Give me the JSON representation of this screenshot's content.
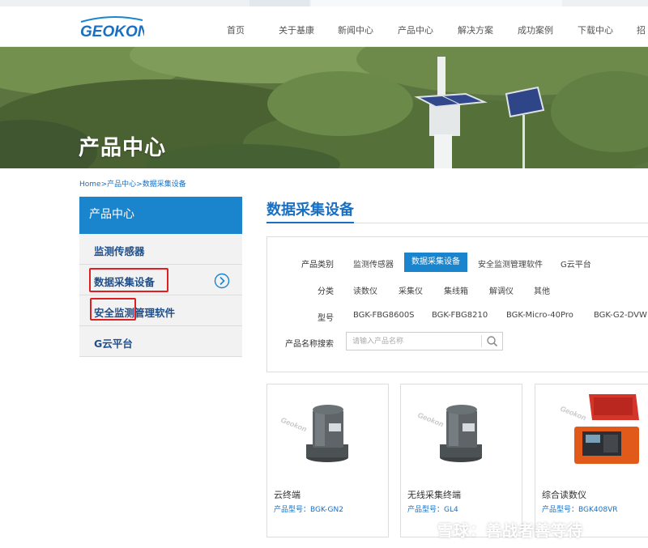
{
  "header": {
    "logo_text": "GEOKON",
    "nav": [
      "首页",
      "关于基康",
      "新闻中心",
      "产品中心",
      "解决方案",
      "成功案例",
      "下载中心",
      "招"
    ]
  },
  "hero": {
    "title": "产品中心"
  },
  "breadcrumb": {
    "items": [
      "Home",
      "产品中心",
      "数据采集设备"
    ],
    "separator": ">"
  },
  "sidebar": {
    "title": "产品中心",
    "items": [
      {
        "label": "监测传感器"
      },
      {
        "label": "数据采集设备"
      },
      {
        "label": "安全监测管理软件"
      },
      {
        "label": "G云平台"
      }
    ]
  },
  "main": {
    "title": "数据采集设备",
    "filters": {
      "category": {
        "label": "产品类别",
        "options": [
          "监测传感器",
          "数据采集设备",
          "安全监测管理软件",
          "G云平台"
        ],
        "selected": "数据采集设备"
      },
      "classification": {
        "label": "分类",
        "options": [
          "读数仪",
          "采集仪",
          "集线箱",
          "解调仪",
          "其他"
        ]
      },
      "model": {
        "label": "型号",
        "options": [
          "BGK-FBG8600S",
          "BGK-FBG8210",
          "BGK-Micro-40Pro",
          "BGK-G2-DVW"
        ]
      },
      "search": {
        "label": "产品名称搜索",
        "placeholder": "请输入产品名称"
      }
    },
    "products": [
      {
        "name": "云终端",
        "model_label": "产品型号：",
        "model": "BGK-GN2"
      },
      {
        "name": "无线采集终端",
        "model_label": "产品型号：",
        "model": "GL4"
      },
      {
        "name": "综合读数仪",
        "model_label": "产品型号：",
        "model": "BGK408VR"
      }
    ],
    "product_watermark": "Geokon"
  },
  "watermark": "雪球：善战者善等待",
  "colors": {
    "accent": "#1a85cd",
    "link": "#1a6fc0",
    "highlight_box": "#e02020"
  }
}
